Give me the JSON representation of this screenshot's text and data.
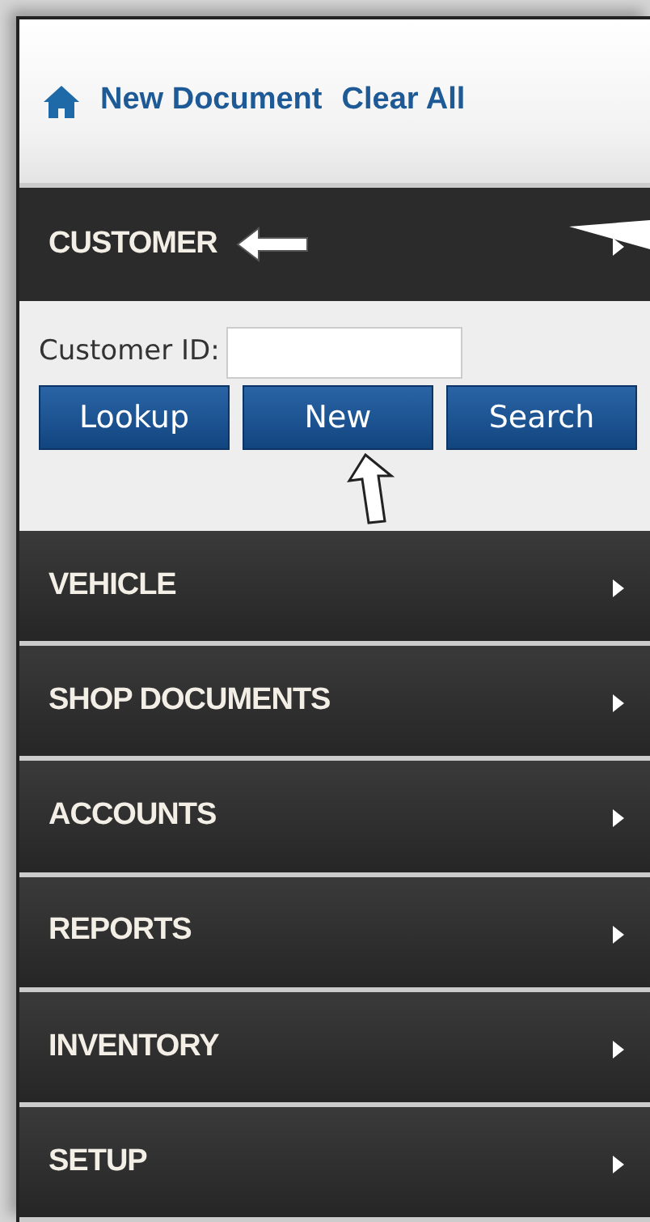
{
  "toolbar": {
    "links": [
      "New Document",
      "Clear All"
    ]
  },
  "sections": [
    {
      "title": "CUSTOMER",
      "expanded": true,
      "field_label": "Customer ID:",
      "buttons": [
        "Lookup",
        "New",
        "Search"
      ]
    },
    {
      "title": "VEHICLE",
      "expanded": false
    },
    {
      "title": "SHOP DOCUMENTS",
      "expanded": false
    },
    {
      "title": "ACCOUNTS",
      "expanded": false
    },
    {
      "title": "REPORTS",
      "expanded": false
    },
    {
      "title": "INVENTORY",
      "expanded": false
    },
    {
      "title": "SETUP",
      "expanded": false
    }
  ]
}
